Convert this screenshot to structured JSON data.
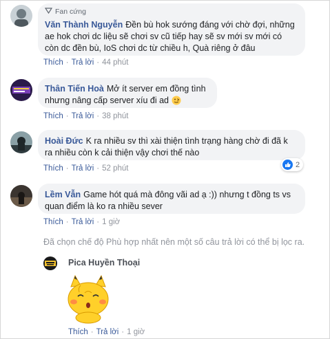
{
  "comments": [
    {
      "badge": "Fan cứng",
      "author": "Văn Thành Nguyễn",
      "text": "Đền bù hok sướng đáng với chờ đợi, những ae hok chơi dc liệu sẽ chơi sv cũ tiếp hay sẽ sv mới sv mới có còn dc đền bù, IoS chơi dc từ chiều h, Quà riêng ở đâu",
      "like": "Thích",
      "reply": "Trả lời",
      "time": "44 phút"
    },
    {
      "author": "Thân Tiến Hoà",
      "text": "Mở ít server em đồng tình nhưng nâng cấp server xíu đi ad",
      "emoji": "🙂",
      "like": "Thích",
      "reply": "Trả lời",
      "time": "38 phút"
    },
    {
      "author": "Hoài Đức",
      "text": "K ra nhiều sv thì xài thiện tình trạng hàng chờ đi đã k ra nhiều còn k cải thiện vậy chơi thế nào",
      "like": "Thích",
      "reply": "Trả lời",
      "time": "52 phút",
      "reactions": "2"
    },
    {
      "author": "Lềm Vẫn",
      "text": "Game hót quá mà đông vãi ad ạ :)) nhưng t đồng ts vs quan điểm là ko ra nhiều sever",
      "like": "Thích",
      "reply": "Trả lời",
      "time": "1 giờ"
    }
  ],
  "filter_note": "Đã chọn chế độ Phù hợp nhất nên một số câu trả lời có thể bị lọc ra.",
  "reply": {
    "author": "Pica Huyền Thoại",
    "like": "Thích",
    "reply": "Trả lời",
    "time": "1 giờ"
  },
  "colors": {
    "link": "#385898",
    "bubble": "#f2f3f5",
    "muted": "#90949c",
    "like_blue": "#1877f2",
    "sticker_yellow": "#ffd02a"
  },
  "icons": [
    "fan-badge-icon",
    "like-icon",
    "emoji-icon",
    "sticker"
  ]
}
